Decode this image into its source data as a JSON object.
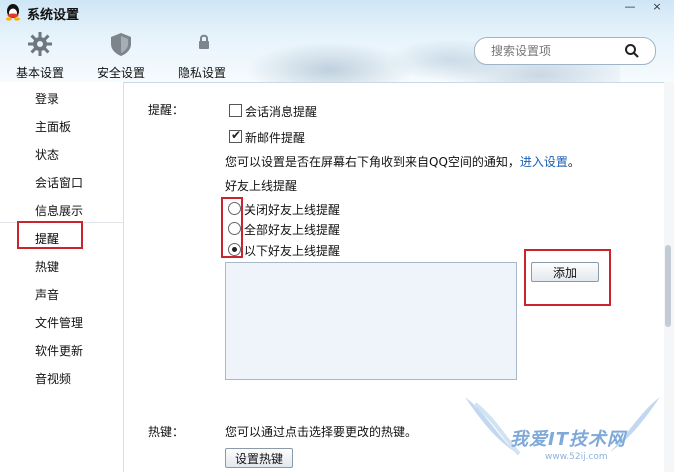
{
  "window": {
    "title": "系统设置",
    "minimize": "—",
    "close": "×"
  },
  "toolbar": [
    {
      "label": "基本设置",
      "icon": "gear-icon"
    },
    {
      "label": "安全设置",
      "icon": "shield-icon"
    },
    {
      "label": "隐私设置",
      "icon": "privacy-icon"
    }
  ],
  "search": {
    "placeholder": "搜索设置项"
  },
  "sidebar": {
    "items": [
      {
        "label": "登录"
      },
      {
        "label": "主面板"
      },
      {
        "label": "状态"
      },
      {
        "label": "会话窗口"
      },
      {
        "label": "信息展示"
      },
      {
        "label": "提醒",
        "selected": true
      },
      {
        "label": "热键"
      },
      {
        "label": "声音"
      },
      {
        "label": "文件管理"
      },
      {
        "label": "软件更新"
      },
      {
        "label": "音视频"
      }
    ]
  },
  "reminder": {
    "section_label": "提醒：",
    "chat_msg": {
      "label": "会话消息提醒",
      "checked": false
    },
    "new_mail": {
      "label": "新邮件提醒",
      "checked": true
    },
    "qzone_note": "您可以设置是否在屏幕右下角收到来自QQ空间的通知，",
    "qzone_link": "进入设置",
    "qzone_end": "。",
    "friend_online_title": "好友上线提醒",
    "options": [
      {
        "label": "关闭好友上线提醒",
        "selected": false
      },
      {
        "label": "全部好友上线提醒",
        "selected": false
      },
      {
        "label": "以下好友上线提醒",
        "selected": true
      }
    ],
    "add_button": "添加"
  },
  "hotkey": {
    "section_label": "热键：",
    "note": "您可以通过点击选择要更改的热键。",
    "button": "设置热键"
  },
  "watermark": {
    "text": "我爱IT技术网",
    "url": "www.52ij.com"
  },
  "colors": {
    "highlight_red": "#c8262c",
    "link": "#1a5fb4"
  }
}
